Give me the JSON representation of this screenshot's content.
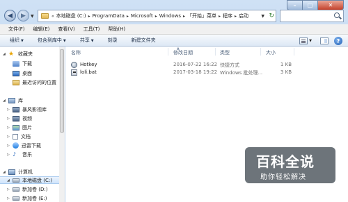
{
  "addressbar": {
    "path": [
      "本地磁盘 (C:)",
      "ProgramData",
      "Microsoft",
      "Windows",
      "「开始」菜单",
      "程序",
      "启动"
    ]
  },
  "menubar": {
    "items": [
      "文件(F)",
      "编辑(E)",
      "查看(V)",
      "工具(T)",
      "帮助(H)"
    ]
  },
  "commandbar": {
    "organize": "组织",
    "include_in_library": "包含到库中",
    "share_with": "共享",
    "burn": "刻录",
    "new_folder": "新建文件夹"
  },
  "navpane": {
    "favorites": "收藏夹",
    "downloads": "下载",
    "desktop": "桌面",
    "recent": "最近访问的位置",
    "libraries": "库",
    "storm_library": "暴风影视库",
    "videos": "视频",
    "pictures": "图片",
    "documents": "文档",
    "thunder_downloads": "迅雷下载",
    "music": "音乐",
    "computer": "计算机",
    "drive_c": "本地磁盘 (C:)",
    "drive_d": "新加卷 (D:)",
    "drive_e": "新加卷 (E:)"
  },
  "columns": {
    "name": "名称",
    "date": "修改日期",
    "type": "类型",
    "size": "大小"
  },
  "files": [
    {
      "name": "Hotkey",
      "date": "2016-07-22 16:22",
      "type": "快捷方式",
      "size": "1 KB",
      "icon": "shortcut-icon"
    },
    {
      "name": "loli.bat",
      "date": "2017-03-18 19:22",
      "type": "Windows 批处理...",
      "size": "3 KB",
      "icon": "batch-file-icon"
    }
  ],
  "watermark": {
    "title": "百科全说",
    "subtitle": "助你轻松解决"
  },
  "colors": {
    "frame": "#c5daf0",
    "selection": "#cfe4fb",
    "close_button": "#c4412b"
  }
}
